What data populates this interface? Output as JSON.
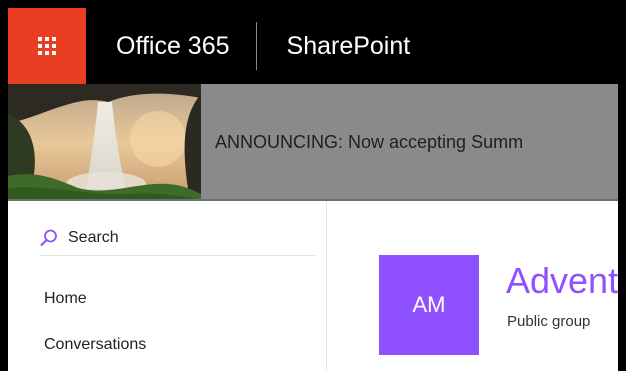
{
  "suite_bar": {
    "waffle_icon": "app-launcher-icon",
    "brand": "Office 365",
    "app_name": "SharePoint",
    "waffle_color": "#ea3e23"
  },
  "banner": {
    "announcement": "ANNOUNCING: Now accepting Summ",
    "image": "waterfall-landscape"
  },
  "left_nav": {
    "search_placeholder": "Search",
    "items": [
      {
        "label": "Home"
      },
      {
        "label": "Conversations"
      }
    ]
  },
  "group": {
    "initials": "AM",
    "title": "Advent",
    "subtitle": "Public group",
    "accent": "#8f50ff"
  }
}
